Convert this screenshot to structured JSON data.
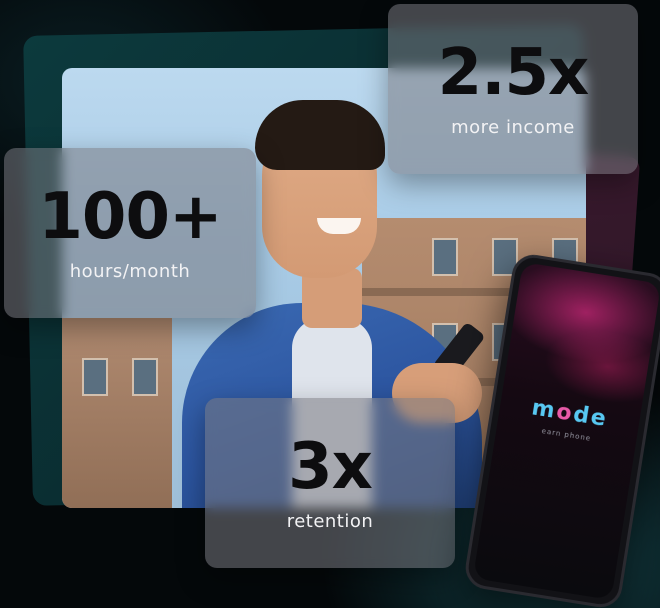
{
  "stats": {
    "income": {
      "value": "2.5x",
      "label": "more income"
    },
    "hours": {
      "value": "100+",
      "label": "hours/month"
    },
    "retention": {
      "value": "3x",
      "label": "retention"
    }
  },
  "device": {
    "logo_part1": "m",
    "logo_accent": "o",
    "logo_part2": "de",
    "tagline": "earn phone"
  },
  "colors": {
    "background": "#04080a",
    "teal_panel": "#0c3a3d",
    "card": "#78787f",
    "value_text": "#0d0d0f",
    "label_text": "#f2f2f4",
    "logo_blue": "#58c8f2",
    "logo_pink": "#e85aa8"
  }
}
